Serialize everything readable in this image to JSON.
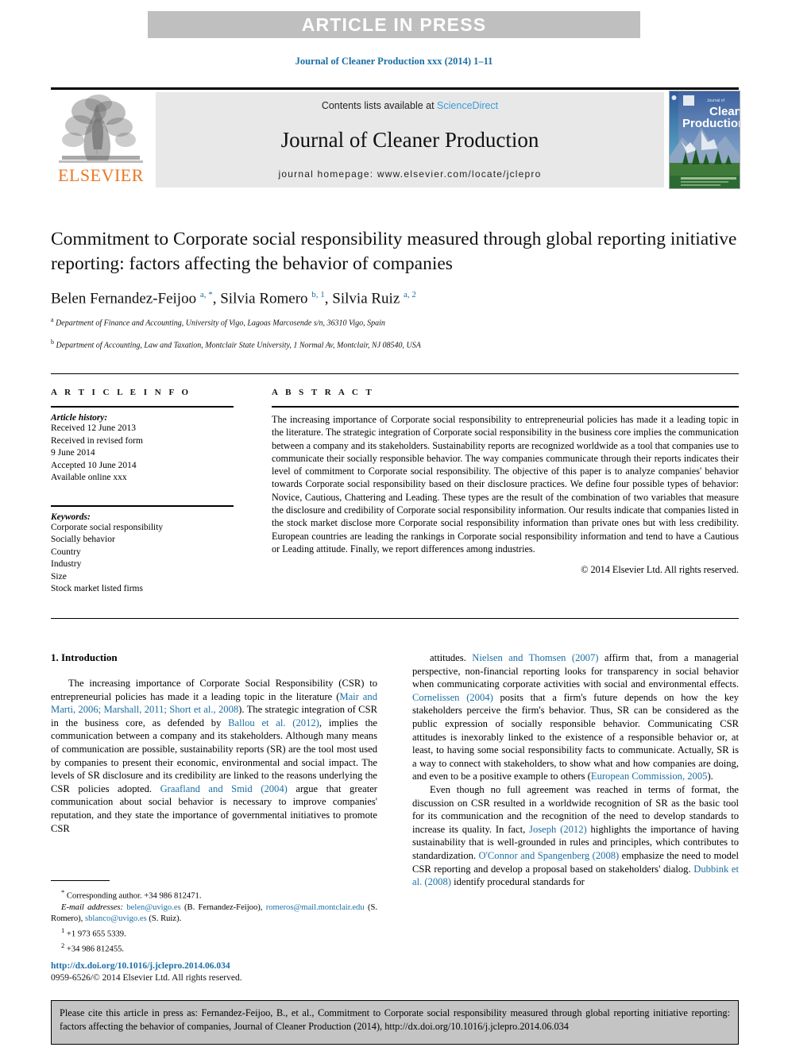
{
  "banner": {
    "text": "ARTICLE IN PRESS"
  },
  "running_head": "Journal of Cleaner Production xxx (2014) 1–11",
  "masthead": {
    "contents_prefix": "Contents lists available at ",
    "sciencedirect": "ScienceDirect",
    "journal_name": "Journal of Cleaner Production",
    "homepage": "journal homepage: www.elsevier.com/locate/jclepro",
    "elsevier_wordmark": "ELSEVIER",
    "cover_title_small": "Journal of",
    "cover_title_line1": "Cleaner",
    "cover_title_line2": "Production"
  },
  "article": {
    "title": "Commitment to Corporate social responsibility measured through global reporting initiative reporting: factors affecting the behavior of companies",
    "authors_html": "Belen Fernandez-Feijoo <sup>a, *</sup>, Silvia Romero <sup>b, 1</sup>, Silvia Ruiz <sup>a, 2</sup>",
    "affiliations": [
      {
        "marker": "a",
        "text": "Department of Finance and Accounting, University of Vigo, Lagoas Marcosende s/n, 36310 Vigo, Spain"
      },
      {
        "marker": "b",
        "text": "Department of Accounting, Law and Taxation, Montclair State University, 1 Normal Av, Montclair, NJ 08540, USA"
      }
    ]
  },
  "article_info": {
    "heading": "A R T I C L E   I N F O",
    "history_label": "Article history:",
    "history_lines": [
      "Received 12 June 2013",
      "Received in revised form",
      "9 June 2014",
      "Accepted 10 June 2014",
      "Available online xxx"
    ],
    "keywords_label": "Keywords:",
    "keywords": [
      "Corporate social responsibility",
      "Socially behavior",
      "Country",
      "Industry",
      "Size",
      "Stock market listed firms"
    ]
  },
  "abstract": {
    "heading": "A B S T R A C T",
    "text": "The increasing importance of Corporate social responsibility to entrepreneurial policies has made it a leading topic in the literature. The strategic integration of Corporate social responsibility in the business core implies the communication between a company and its stakeholders. Sustainability reports are recognized worldwide as a tool that companies use to communicate their socially responsible behavior. The way companies communicate through their reports indicates their level of commitment to Corporate social responsibility. The objective of this paper is to analyze companies' behavior towards Corporate social responsibility based on their disclosure practices. We define four possible types of behavior: Novice, Cautious, Chattering and Leading. These types are the result of the combination of two variables that measure the disclosure and credibility of Corporate social responsibility information. Our results indicate that companies listed in the stock market disclose more Corporate social responsibility information than private ones but with less credibility. European countries are leading the rankings in Corporate social responsibility information and tend to have a Cautious or Leading attitude. Finally, we report differences among industries.",
    "copyright": "© 2014 Elsevier Ltd. All rights reserved."
  },
  "introduction": {
    "heading": "1. Introduction",
    "left_paragraph_html": "The increasing importance of Corporate Social Responsibility (CSR) to entrepreneurial policies has made it a leading topic in the literature (<span class=\"ref\">Mair and Marti, 2006; Marshall, 2011; Short et al., 2008</span>). The strategic integration of CSR in the business core, as defended by <span class=\"ref\">Ballou et al. (2012)</span>, implies the communication between a company and its stakeholders. Although many means of communication are possible, sustainability reports (SR) are the tool most used by companies to present their economic, environmental and social impact. The levels of SR disclosure and its credibility are linked to the reasons underlying the CSR policies adopted. <span class=\"ref\">Graafland and Smid (2004)</span> argue that greater communication about social behavior is necessary to improve companies' reputation, and they state the importance of governmental initiatives to promote CSR",
    "right_paragraph1_html": "attitudes. <span class=\"ref\">Nielsen and Thomsen (2007)</span> affirm that, from a managerial perspective, non-financial reporting looks for transparency in social behavior when communicating corporate activities with social and environmental effects. <span class=\"ref\">Cornelissen (2004)</span> posits that a firm's future depends on how the key stakeholders perceive the firm's behavior. Thus, SR can be considered as the public expression of socially responsible behavior. Communicating CSR attitudes is inexorably linked to the existence of a responsible behavior or, at least, to having some social responsibility facts to communicate. Actually, SR is a way to connect with stakeholders, to show what and how companies are doing, and even to be a positive example to others (<span class=\"ref\">European Commission, 2005</span>).",
    "right_paragraph2_html": "Even though no full agreement was reached in terms of format, the discussion on CSR resulted in a worldwide recognition of SR as the basic tool for its communication and the recognition of the need to develop standards to increase its quality. In fact, <span class=\"ref\">Joseph (2012)</span> highlights the importance of having sustainability that is well-grounded in rules and principles, which contributes to standardization. <span class=\"ref\">O'Connor and Spangenberg (2008)</span> emphasize the need to model CSR reporting and develop a proposal based on stakeholders' dialog. <span class=\"ref\">Dubbink et al. (2008)</span> identify procedural standards for"
  },
  "footnotes": {
    "corresponding_html": "<sup>*</sup> Corresponding author. +34 986 812471.",
    "emails_html": "<span class=\"fn-em\">E-mail addresses:</span> <span class=\"ref\">belen@uvigo.es</span> (B. Fernandez-Feijoo), <span class=\"ref\">romeros@mail.montclair.edu</span> (S. Romero), <span class=\"ref\">sblanco@uvigo.es</span> (S. Ruiz).",
    "note1_html": "<sup>1</sup> +1 973 655 5339.",
    "note2_html": "<sup>2</sup> +34 986 812455.",
    "doi": "http://dx.doi.org/10.1016/j.jclepro.2014.06.034",
    "issn": "0959-6526/© 2014 Elsevier Ltd. All rights reserved."
  },
  "cite_box": {
    "text": "Please cite this article in press as: Fernandez-Feijoo, B., et al., Commitment to Corporate social responsibility measured through global reporting initiative reporting: factors affecting the behavior of companies, Journal of Cleaner Production (2014), http://dx.doi.org/10.1016/j.jclepro.2014.06.034"
  },
  "colors": {
    "link": "#1c6ea4",
    "sciencedirect": "#3a9bd9",
    "elsevier_orange": "#e87722",
    "banner_gray": "#bfbfbf",
    "band_gray": "#e8e8e8",
    "cite_gray": "#c4c4c4"
  }
}
